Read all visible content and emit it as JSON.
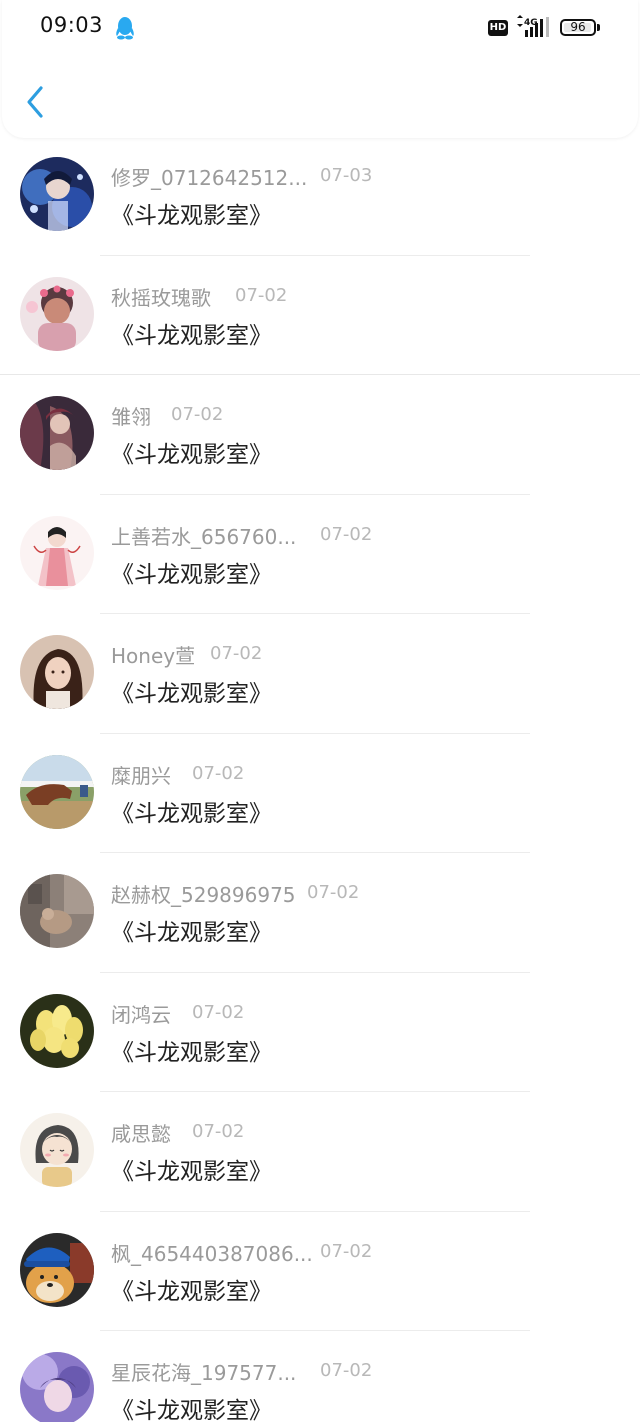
{
  "status_bar": {
    "time": "09:03",
    "hd": "HD",
    "network": "4G",
    "battery": "96",
    "battery_level": 0.96,
    "icons": [
      "qq-penguin-icon",
      "hd-icon",
      "signal-icon",
      "battery-icon"
    ]
  },
  "header": {
    "back_icon": "chevron-left-icon",
    "accent": "#2d9ee0"
  },
  "list": [
    {
      "name": "修罗_0712642512...",
      "date": "07-03",
      "message": "《斗龙观影室》"
    },
    {
      "name": "秋摇玫瑰歌",
      "date": "07-02",
      "message": "《斗龙观影室》"
    },
    {
      "name": "雏翎",
      "date": "07-02",
      "message": "《斗龙观影室》"
    },
    {
      "name": "上善若水_656760...",
      "date": "07-02",
      "message": "《斗龙观影室》"
    },
    {
      "name": "Honey萱",
      "date": "07-02",
      "message": "《斗龙观影室》"
    },
    {
      "name": "糜朋兴",
      "date": "07-02",
      "message": "《斗龙观影室》"
    },
    {
      "name": "赵赫权_529896975",
      "date": "07-02",
      "message": "《斗龙观影室》"
    },
    {
      "name": "闭鸿云",
      "date": "07-02",
      "message": "《斗龙观影室》"
    },
    {
      "name": "咸思懿",
      "date": "07-02",
      "message": "《斗龙观影室》"
    },
    {
      "name": "枫_465440387086...",
      "date": "07-02",
      "message": "《斗龙观影室》"
    },
    {
      "name": "星辰花海_197577...",
      "date": "07-02",
      "message": "《斗龙观影室》"
    }
  ]
}
